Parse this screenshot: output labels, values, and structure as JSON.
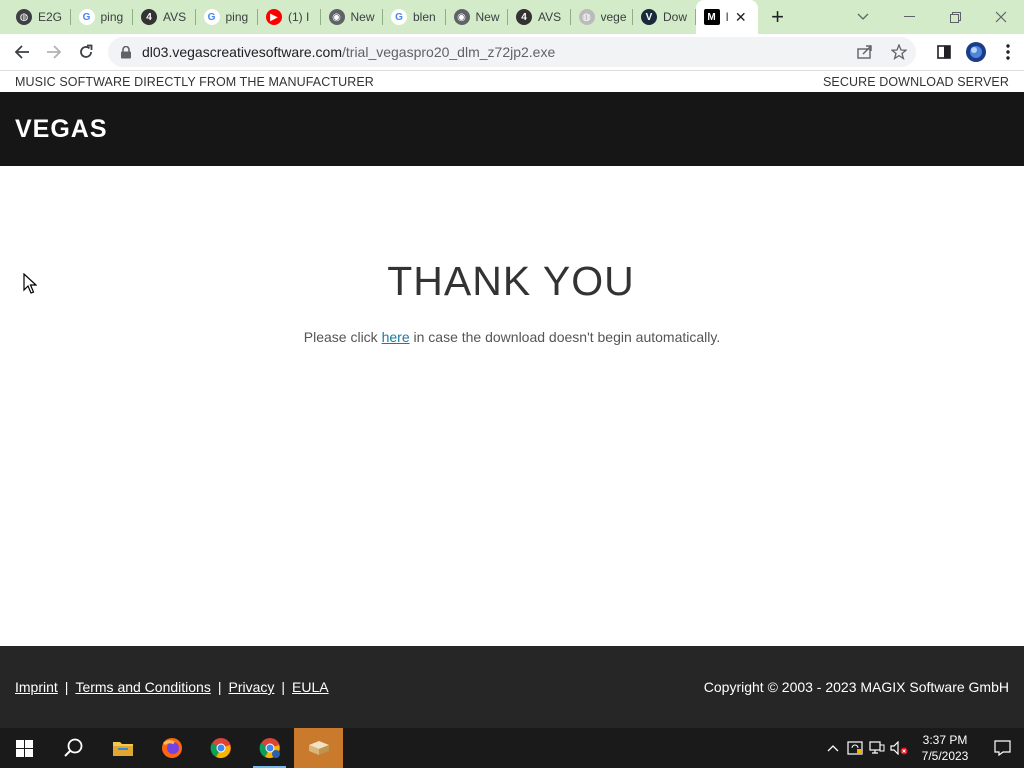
{
  "browser": {
    "tabs": [
      {
        "label": "E2G",
        "icon": "globe-icon",
        "fav_bg": "#3c4043",
        "fav_fg": "#ffffff",
        "glyph": "◍"
      },
      {
        "label": "ping",
        "icon": "google-icon",
        "fav_bg": "#ffffff",
        "fav_fg": "#4285f4",
        "glyph": "G"
      },
      {
        "label": "AVS",
        "icon": "avs4you-icon",
        "fav_bg": "#333333",
        "fav_fg": "#ffffff",
        "glyph": "4"
      },
      {
        "label": "ping",
        "icon": "google-icon",
        "fav_bg": "#ffffff",
        "fav_fg": "#4285f4",
        "glyph": "G"
      },
      {
        "label": "(1) I",
        "icon": "youtube-icon",
        "fav_bg": "#ff0000",
        "fav_fg": "#ffffff",
        "glyph": "▶"
      },
      {
        "label": "New",
        "icon": "chrome-icon",
        "fav_bg": "#5f6368",
        "fav_fg": "#ffffff",
        "glyph": "◉"
      },
      {
        "label": "blen",
        "icon": "google-icon",
        "fav_bg": "#ffffff",
        "fav_fg": "#4285f4",
        "glyph": "G"
      },
      {
        "label": "New",
        "icon": "chrome-icon",
        "fav_bg": "#5f6368",
        "fav_fg": "#ffffff",
        "glyph": "◉"
      },
      {
        "label": "AVS",
        "icon": "avs4you-icon",
        "fav_bg": "#333333",
        "fav_fg": "#ffffff",
        "glyph": "4"
      },
      {
        "label": "vege",
        "icon": "loading-globe-icon",
        "fav_bg": "#bbbbbb",
        "fav_fg": "#ffffff",
        "glyph": "◍"
      },
      {
        "label": "Dow",
        "icon": "vegas-v-icon",
        "fav_bg": "#1b2a3a",
        "fav_fg": "#ffffff",
        "glyph": "V"
      }
    ],
    "active_tab": {
      "label": "I",
      "icon": "magix-m-icon",
      "glyph": "M"
    },
    "new_tab": "+",
    "url_host": "dl03.vegascreativesoftware.com",
    "url_path": "/trial_vegaspro20_dlm_z72jp2.exe"
  },
  "page": {
    "topline_left": "MUSIC SOFTWARE DIRECTLY FROM THE MANUFACTURER",
    "topline_right": "SECURE DOWNLOAD SERVER",
    "brand": "VEGAS",
    "heading": "THANK YOU",
    "note_before": "Please click ",
    "note_link": "here",
    "note_after": " in case the download doesn't begin automatically.",
    "footer_links": [
      "Imprint",
      "Terms and Conditions",
      "Privacy",
      "EULA"
    ],
    "copyright": "Copyright © 2003 - 2023 MAGIX Software GmbH"
  },
  "taskbar": {
    "time": "3:37 PM",
    "date": "7/5/2023"
  }
}
